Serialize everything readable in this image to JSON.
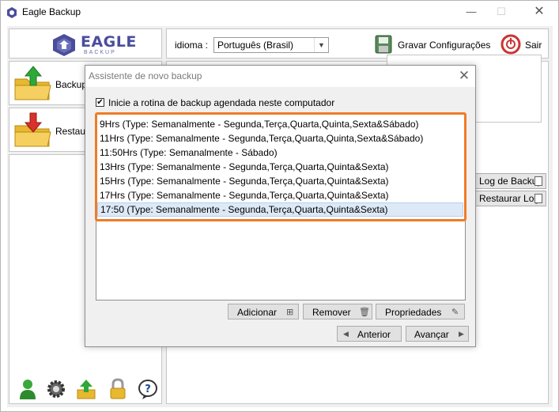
{
  "window": {
    "title": "Eagle Backup",
    "minimize_glyph": "—",
    "maximize_glyph": "☐",
    "close_glyph": "✕"
  },
  "logo": {
    "name": "EAGLE",
    "sub": "BACKUP"
  },
  "toolbar": {
    "language_label": "idioma :",
    "language_value": "Português (Brasil)",
    "save_label": "Gravar Configurações",
    "exit_label": "Sair"
  },
  "sidebar": {
    "items": [
      {
        "label": "Backup"
      },
      {
        "label": "Restaurar"
      }
    ],
    "bottom_icons": [
      "user-icon",
      "gear-icon",
      "upload-icon",
      "lock-icon",
      "help-icon"
    ]
  },
  "main": {
    "peek_buttons": [
      {
        "label": "Log de Backup"
      },
      {
        "label": "Restaurar Log"
      }
    ]
  },
  "dialog": {
    "title": "Assistente de novo backup",
    "close_glyph": "✕",
    "checkbox_checked": true,
    "checkbox_label": "Inicie a rotina de backup agendada neste computador",
    "schedules": [
      "9Hrs (Type: Semanalmente - Segunda,Terça,Quarta,Quinta,Sexta&Sábado)",
      "11Hrs (Type: Semanalmente - Segunda,Terça,Quarta,Quinta,Sexta&Sábado)",
      "11:50Hrs (Type: Semanalmente - Sábado)",
      "13Hrs (Type: Semanalmente - Segunda,Terça,Quarta,Quinta&Sexta)",
      "15Hrs (Type: Semanalmente - Segunda,Terça,Quarta,Quinta&Sexta)",
      "17Hrs (Type: Semanalmente - Segunda,Terça,Quarta,Quinta&Sexta)",
      "17:50 (Type: Semanalmente - Segunda,Terça,Quarta,Quinta&Sexta)"
    ],
    "selected_index": 6,
    "buttons": {
      "add": "Adicionar",
      "remove": "Remover",
      "properties": "Propriedades",
      "previous": "Anterior",
      "next": "Avançar"
    }
  },
  "colors": {
    "highlight": "#f07c27",
    "logo": "#4a4e9a",
    "selection": "#dde9f7"
  }
}
